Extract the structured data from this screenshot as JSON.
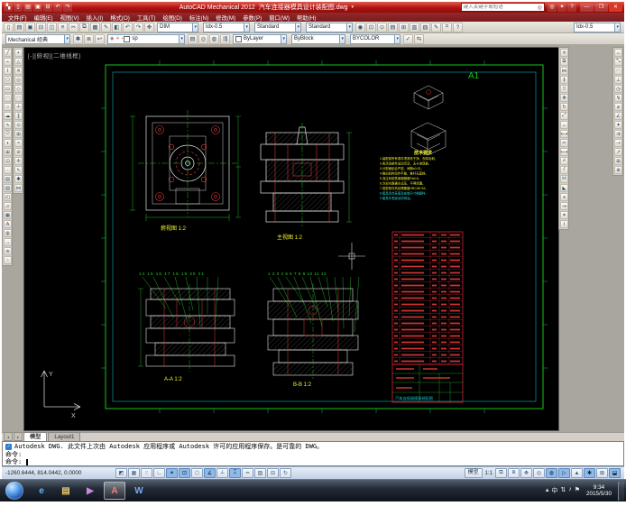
{
  "colors": {
    "titlebar_red": "#b01210",
    "menubar_maroon": "#8a2224",
    "toolbar_gray": "#d4d0c8",
    "canvas_black": "#000000",
    "frame_green": "#17c417",
    "detail_cyan": "#0fb3b3",
    "entity_white": "#e6e6e6",
    "entity_red": "#e23c3c",
    "annotation_yellow": "#f5f52a",
    "bom_red": "#cc3333",
    "status_blue": "#c3d2e6",
    "taskbar_dark": "#0e141d"
  },
  "titlebar": {
    "app_title": "AutoCAD Mechanical 2012",
    "doc_name": "汽车连接器模具设计装配图.dwg",
    "search_placeholder": "键入关键字或短语",
    "qat_icons": [
      {
        "name": "app-menu-icon",
        "glyph": "▚"
      },
      {
        "name": "qnew-icon",
        "glyph": "▯"
      },
      {
        "name": "open-icon",
        "glyph": "▤"
      },
      {
        "name": "save-icon",
        "glyph": "▣"
      },
      {
        "name": "plot-icon",
        "glyph": "⊟"
      },
      {
        "name": "undo-icon",
        "glyph": "↶"
      },
      {
        "name": "redo-icon",
        "glyph": "↷"
      }
    ],
    "info_icons": [
      {
        "name": "search-icon",
        "glyph": "◎"
      },
      {
        "name": "exchange-icon",
        "glyph": "✦"
      },
      {
        "name": "help-icon",
        "glyph": "?"
      }
    ],
    "win_buttons": [
      {
        "name": "minimize-button",
        "glyph": "—"
      },
      {
        "name": "restore-button",
        "glyph": "❐"
      },
      {
        "name": "close-button",
        "glyph": "✕"
      }
    ]
  },
  "menubar": {
    "items": [
      "文件(F)",
      "编辑(E)",
      "视图(V)",
      "插入(I)",
      "格式(O)",
      "工具(T)",
      "绘图(D)",
      "标注(N)",
      "修改(M)",
      "参数(P)",
      "窗口(W)",
      "帮助(H)"
    ]
  },
  "toolbar1": {
    "left_icons": [
      {
        "name": "qnew-icon",
        "glyph": "▯"
      },
      {
        "name": "open-icon",
        "glyph": "▤"
      },
      {
        "name": "save-icon",
        "glyph": "▣"
      },
      {
        "name": "plot-icon",
        "glyph": "⊟"
      },
      {
        "name": "plot-preview-icon",
        "glyph": "◫"
      },
      {
        "name": "publish-icon",
        "glyph": "≡"
      },
      {
        "name": "cut-icon",
        "glyph": "✂"
      },
      {
        "name": "copy-clip-icon",
        "glyph": "⧉"
      },
      {
        "name": "paste-icon",
        "glyph": "▦"
      },
      {
        "name": "match-properties-icon",
        "glyph": "✎"
      },
      {
        "name": "block-editor-icon",
        "glyph": "◧"
      },
      {
        "name": "undo-icon",
        "glyph": "↶"
      },
      {
        "name": "redo-icon",
        "glyph": "↷"
      },
      {
        "name": "pan-icon",
        "glyph": "✥"
      }
    ],
    "dim_style": "DIM",
    "mech_scale": "Idx-0.5",
    "text_style": "Standard",
    "table_style": "Standard",
    "right_icons": [
      {
        "name": "zoom-realtime-icon",
        "glyph": "◉"
      },
      {
        "name": "zoom-window-icon",
        "glyph": "⊡"
      },
      {
        "name": "zoom-previous-icon",
        "glyph": "⊙"
      },
      {
        "name": "properties-icon",
        "glyph": "▤"
      },
      {
        "name": "design-center-icon",
        "glyph": "⊞"
      },
      {
        "name": "tool-palettes-icon",
        "glyph": "▥"
      },
      {
        "name": "sheet-set-icon",
        "glyph": "▧"
      },
      {
        "name": "markup-icon",
        "glyph": "✎"
      },
      {
        "name": "quickcalc-icon",
        "glyph": "⌗"
      },
      {
        "name": "help-icon",
        "glyph": "?"
      }
    ],
    "far_combo": "Idx-0.5"
  },
  "toolbar2": {
    "workspace": "Mechanical 经典",
    "icons_a": [
      {
        "name": "workspace-settings-icon",
        "glyph": "✱"
      },
      {
        "name": "layer-properties-icon",
        "glyph": "≣"
      },
      {
        "name": "layer-previous-icon",
        "glyph": "↩"
      }
    ],
    "layer_status_icons": [
      {
        "name": "layer-on-icon",
        "glyph": "◉"
      },
      {
        "name": "layer-freeze-icon",
        "glyph": "✳"
      },
      {
        "name": "layer-lock-icon",
        "glyph": "▪"
      }
    ],
    "layer_name": "sp",
    "icons_b": [
      {
        "name": "layer-states-icon",
        "glyph": "▤"
      },
      {
        "name": "layer-isolate-icon",
        "glyph": "◎"
      },
      {
        "name": "layer-unisolate-icon",
        "glyph": "◍"
      },
      {
        "name": "layer-walk-icon",
        "glyph": "⇶"
      }
    ],
    "color_value": "ByLayer",
    "linetype_value": "ByBlock",
    "plotstyle_value": "BYCOLOR",
    "icons_c": [
      {
        "name": "make-current-icon",
        "glyph": "✓"
      },
      {
        "name": "match-layer-icon",
        "glyph": "⇆"
      }
    ]
  },
  "left_toolbar": {
    "draw_icons": [
      {
        "name": "line-icon",
        "glyph": "╱"
      },
      {
        "name": "construction-line-icon",
        "glyph": "⌁"
      },
      {
        "name": "polyline-icon",
        "glyph": "⌇"
      },
      {
        "name": "polygon-icon",
        "glyph": "⬠"
      },
      {
        "name": "rectangle-icon",
        "glyph": "▭"
      },
      {
        "name": "arc-icon",
        "glyph": "◠"
      },
      {
        "name": "circle-icon",
        "glyph": "○"
      },
      {
        "name": "revision-cloud-icon",
        "glyph": "☁"
      },
      {
        "name": "spline-icon",
        "glyph": "∿"
      },
      {
        "name": "ellipse-icon",
        "glyph": "⬭"
      },
      {
        "name": "ellipse-arc-icon",
        "glyph": "◖"
      },
      {
        "name": "insert-block-icon",
        "glyph": "⊞"
      },
      {
        "name": "make-block-icon",
        "glyph": "⊡"
      },
      {
        "name": "point-icon",
        "glyph": "·"
      },
      {
        "name": "hatch-icon",
        "glyph": "▨"
      },
      {
        "name": "gradient-icon",
        "glyph": "▧"
      },
      {
        "name": "region-icon",
        "glyph": "◰"
      },
      {
        "name": "wipeout-icon",
        "glyph": "▱"
      },
      {
        "name": "table-icon",
        "glyph": "▦"
      },
      {
        "name": "mtext-icon",
        "glyph": "A"
      },
      {
        "name": "donut-icon",
        "glyph": "◍"
      },
      {
        "name": "ray-icon",
        "glyph": "→"
      },
      {
        "name": "multiline-icon",
        "glyph": "≋"
      },
      {
        "name": "divide-icon",
        "glyph": "⁘"
      }
    ],
    "extra_icons": [
      {
        "name": "snap-endpoint-icon",
        "glyph": "▪"
      },
      {
        "name": "snap-midpoint-icon",
        "glyph": "△"
      },
      {
        "name": "snap-intersection-icon",
        "glyph": "✕"
      },
      {
        "name": "snap-center-icon",
        "glyph": "◎"
      },
      {
        "name": "snap-quadrant-icon",
        "glyph": "◇"
      },
      {
        "name": "snap-tangent-icon",
        "glyph": "◠"
      },
      {
        "name": "snap-perpendicular-icon",
        "glyph": "⟂"
      },
      {
        "name": "snap-parallel-icon",
        "glyph": "∥"
      },
      {
        "name": "snap-node-icon",
        "glyph": "⊙"
      },
      {
        "name": "snap-insert-icon",
        "glyph": "⊞"
      },
      {
        "name": "snap-nearest-icon",
        "glyph": "≈"
      },
      {
        "name": "snap-none-icon",
        "glyph": "⊘"
      },
      {
        "name": "temporary-track-icon",
        "glyph": "✛"
      },
      {
        "name": "snap-from-icon",
        "glyph": "↖"
      },
      {
        "name": "osnap-settings-icon",
        "glyph": "✱"
      },
      {
        "name": "snap-apparent-icon",
        "glyph": "⋈"
      }
    ]
  },
  "right_toolbar": {
    "modify_icons": [
      {
        "name": "erase-icon",
        "glyph": "✕"
      },
      {
        "name": "copy-icon",
        "glyph": "⧉"
      },
      {
        "name": "mirror-icon",
        "glyph": "⋈"
      },
      {
        "name": "offset-icon",
        "glyph": "≬"
      },
      {
        "name": "array-icon",
        "glyph": "⠿"
      },
      {
        "name": "move-icon",
        "glyph": "✥"
      },
      {
        "name": "rotate-icon",
        "glyph": "↻"
      },
      {
        "name": "scale-icon",
        "glyph": "⤢"
      },
      {
        "name": "stretch-icon",
        "glyph": "↔"
      },
      {
        "name": "lengthen-icon",
        "glyph": "⟷"
      },
      {
        "name": "trim-icon",
        "glyph": "✂"
      },
      {
        "name": "extend-icon",
        "glyph": "⟼"
      },
      {
        "name": "break-at-point-icon",
        "glyph": "⌿"
      },
      {
        "name": "break-icon",
        "glyph": "⫽"
      },
      {
        "name": "join-icon",
        "glyph": "⨝"
      },
      {
        "name": "chamfer-icon",
        "glyph": "◣"
      },
      {
        "name": "fillet-icon",
        "glyph": "◕"
      },
      {
        "name": "blend-curves-icon",
        "glyph": "↝"
      },
      {
        "name": "explode-icon",
        "glyph": "✶"
      },
      {
        "name": "edit-polyline-icon",
        "glyph": "⌇"
      }
    ],
    "dim_icons": [
      {
        "name": "dim-linear-icon",
        "glyph": "↔"
      },
      {
        "name": "dim-aligned-icon",
        "glyph": "⤡"
      },
      {
        "name": "dim-arc-length-icon",
        "glyph": "◠"
      },
      {
        "name": "dim-ordinate-icon",
        "glyph": "⊥"
      },
      {
        "name": "dim-radius-icon",
        "glyph": "◷"
      },
      {
        "name": "dim-jogged-icon",
        "glyph": "↯"
      },
      {
        "name": "dim-diameter-icon",
        "glyph": "⌀"
      },
      {
        "name": "dim-angular-icon",
        "glyph": "∠"
      },
      {
        "name": "dim-quick-icon",
        "glyph": "✦"
      },
      {
        "name": "dim-baseline-icon",
        "glyph": "⇉"
      },
      {
        "name": "dim-continue-icon",
        "glyph": "⇢"
      },
      {
        "name": "multileader-icon",
        "glyph": "↗"
      },
      {
        "name": "tolerance-icon",
        "glyph": "⊞"
      },
      {
        "name": "center-mark-icon",
        "glyph": "⊕"
      }
    ]
  },
  "viewport": {
    "label": "[-][俯视][二维线框]",
    "sheet_size": "A1",
    "views": {
      "plan_label": "俯视图 1:2",
      "front_label": "主视图 1:2",
      "section_a_label": "A-A 1:2",
      "section_b_label": "B-B 1:2"
    },
    "balloons_left": "14 15 16 17 18 19 20 21",
    "balloons_right": "1 2 3 4 5 6 7 8 9 10 11 12",
    "tech_title": "技术要求",
    "tech_lines": [
      "1.装配前所有零件须清洗干净，去除毛刺。",
      "2.各活动部件运动灵活，无卡滞现象。",
      "3.分型面贴合严密，间隙≤0.02。",
      "4.推出机构动作平稳，推杆无歪斜。",
      "5.浇注系统表面粗糙度Ra0.8。",
      "6.冷却水路通水试压，不得渗漏。",
      "7.成型零件热处理硬度HRC48~52。",
      "8.模具闭合高度及安装尺寸按图样。",
      "9.模具外表面涂防锈油。"
    ],
    "title_block": "汽车连接器模具装配图",
    "ucs_x": "X",
    "ucs_y": "Y"
  },
  "tabs": {
    "model": "模型",
    "layout": "Layout1"
  },
  "command": {
    "notice": "Autodesk DWG.  此文件上次由 Autodesk 应用程序或 Autodesk 许可的应用程序保存。是可靠的 DWG。",
    "prompt1": "命令:",
    "prompt2": "命令:"
  },
  "statusbar": {
    "coords": "-1260.6444, 814.0442, 0.0000",
    "toggles": [
      {
        "name": "infer-constraints-toggle",
        "glyph": "◩"
      },
      {
        "name": "snap-toggle",
        "glyph": "▦"
      },
      {
        "name": "grid-toggle",
        "glyph": "⁙"
      },
      {
        "name": "ortho-toggle",
        "glyph": "∟"
      },
      {
        "name": "polar-toggle",
        "glyph": "✶"
      },
      {
        "name": "osnap-toggle",
        "glyph": "⊡"
      },
      {
        "name": "3d-osnap-toggle",
        "glyph": "⬡"
      },
      {
        "name": "otrack-toggle",
        "glyph": "∡"
      },
      {
        "name": "ducs-toggle",
        "glyph": "⟂"
      },
      {
        "name": "dyn-toggle",
        "glyph": "⌶"
      },
      {
        "name": "lineweight-toggle",
        "glyph": "━"
      },
      {
        "name": "transparency-toggle",
        "glyph": "▨"
      },
      {
        "name": "quick-properties-toggle",
        "glyph": "⊟"
      },
      {
        "name": "selection-cycling-toggle",
        "glyph": "↻"
      }
    ],
    "model_label": "模型",
    "scale_label": "1:1",
    "right_icons": [
      {
        "name": "quick-view-layouts-icon",
        "glyph": "⧉"
      },
      {
        "name": "quick-view-drawings-icon",
        "glyph": "⧈"
      },
      {
        "name": "pan-icon",
        "glyph": "✥"
      },
      {
        "name": "zoom-icon",
        "glyph": "◎"
      },
      {
        "name": "steering-wheel-icon",
        "glyph": "◍"
      },
      {
        "name": "show-motion-icon",
        "glyph": "▷"
      },
      {
        "name": "annotation-scale-icon",
        "glyph": "▲"
      },
      {
        "name": "workspace-switching-icon",
        "glyph": "✱"
      },
      {
        "name": "toolbar-lock-icon",
        "glyph": "⊠"
      },
      {
        "name": "cleanscreen-icon",
        "glyph": "⬓"
      }
    ]
  },
  "taskbar": {
    "apps": [
      {
        "name": "taskbar-ie",
        "glyph": "e"
      },
      {
        "name": "taskbar-explorer",
        "glyph": "▤"
      },
      {
        "name": "taskbar-media-player",
        "glyph": "▶"
      },
      {
        "name": "taskbar-autocad",
        "glyph": "A"
      },
      {
        "name": "taskbar-word",
        "glyph": "W"
      }
    ],
    "tray": [
      {
        "name": "tray-expand-icon",
        "glyph": "▴"
      },
      {
        "name": "input-method-icon",
        "glyph": "中"
      },
      {
        "name": "network-icon",
        "glyph": "⇅"
      },
      {
        "name": "volume-icon",
        "glyph": "♪"
      },
      {
        "name": "action-center-icon",
        "glyph": "⚑"
      }
    ],
    "clock_time": "9:34",
    "clock_date": "2015/5/30"
  }
}
